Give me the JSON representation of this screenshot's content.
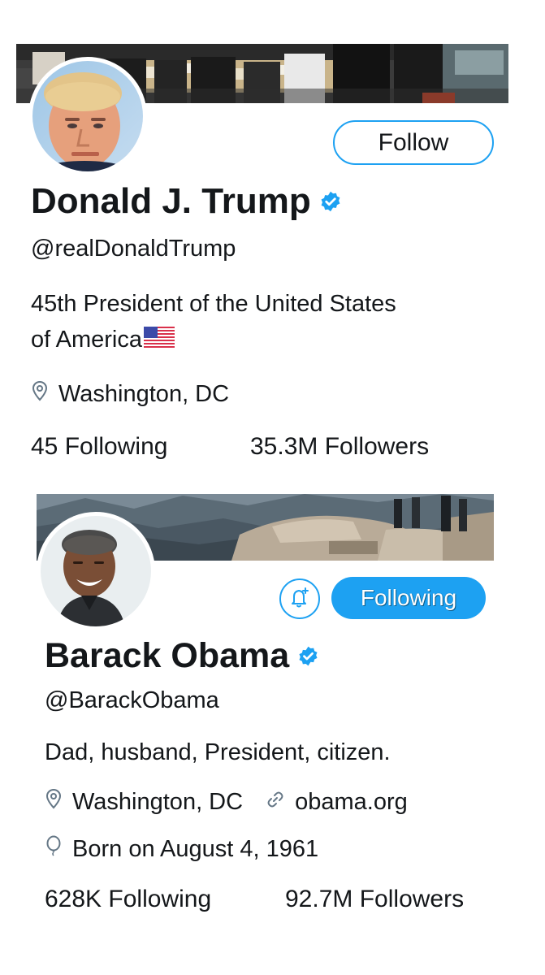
{
  "profiles": [
    {
      "name": "Donald J. Trump",
      "handle": "@realDonaldTrump",
      "bio_line1": "45th President of the United States",
      "bio_line2": "of America",
      "bio_emoji": "flag-usa-icon",
      "location": "Washington, DC",
      "following_count": "45",
      "following_label": "Following",
      "followers_count": "35.3M",
      "followers_label": "Followers",
      "action_label": "Follow",
      "verified": true
    },
    {
      "name": "Barack Obama",
      "handle": "@BarackObama",
      "bio": "Dad, husband, President, citizen.",
      "location": "Washington, DC",
      "website": "obama.org",
      "born": "Born on August 4, 1961",
      "following_count": "628K",
      "following_label": "Following",
      "followers_count": "92.7M",
      "followers_label": "Followers",
      "action_label": "Following",
      "notification_icon": "bell-plus-icon",
      "verified": true
    }
  ],
  "colors": {
    "accent": "#1da1f2",
    "text": "#14171a",
    "muted": "#657786"
  },
  "icons": {
    "verified": "verified-badge-icon",
    "location": "location-pin-icon",
    "link": "link-icon",
    "birthday": "balloon-icon"
  }
}
